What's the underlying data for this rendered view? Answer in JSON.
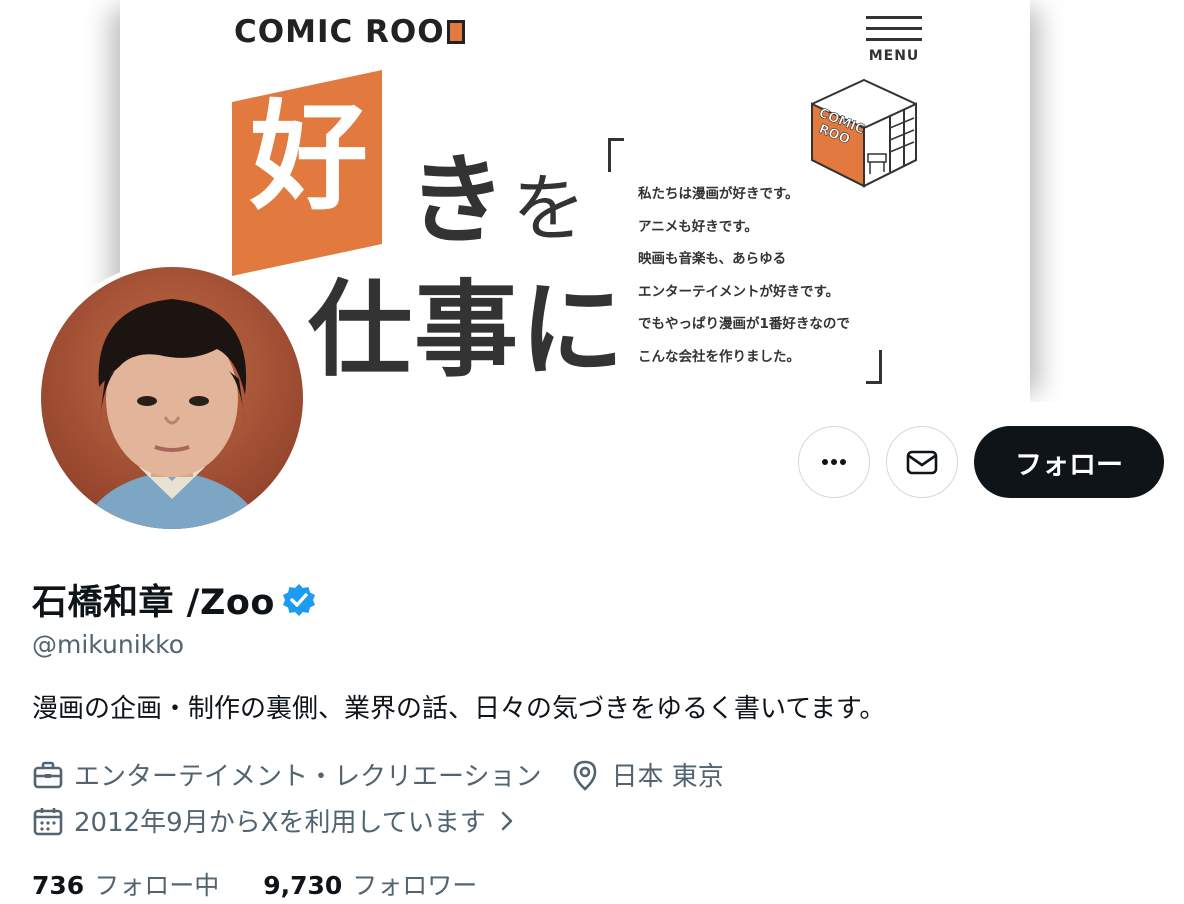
{
  "banner": {
    "brand": "COMIC ROO",
    "menu_label": "MENU",
    "room_sign_line1": "COMIC",
    "room_sign_line2": "ROO",
    "headline_suki": "好",
    "headline_ki": "き",
    "headline_wo": "を",
    "headline_shigoto": "仕事に",
    "blurb": [
      "私たちは漫画が好きです。",
      "アニメも好きです。",
      "映画も音楽も、あらゆる",
      "エンターテイメントが好きです。",
      "でもやっぱり漫画が1番好きなので",
      "こんな会社を作りました。"
    ]
  },
  "actions": {
    "more_icon": "more-icon",
    "message_icon": "mail-icon",
    "follow_label": "フォロー"
  },
  "profile": {
    "display_name": "石橋和章 /Zoo",
    "verified_icon": "verified-badge-icon",
    "handle": "@mikunikko",
    "bio": "漫画の企画・制作の裏側、業界の話、日々の気づきをゆるく書いてます。",
    "category": "エンターテイメント・レクリエーション",
    "location": "日本 東京",
    "joined": "2012年9月からXを利用しています",
    "icons": {
      "category": "briefcase-icon",
      "location": "location-pin-icon",
      "joined": "calendar-icon",
      "joined_more": "chevron-right-icon"
    }
  },
  "stats": {
    "following_count": "736",
    "following_label": "フォロー中",
    "followers_count": "9,730",
    "followers_label": "フォロワー"
  },
  "colors": {
    "accent_orange": "#e27a3f",
    "follow_button": "#0f1419",
    "verified_blue": "#1d9bf0",
    "secondary_text": "#536471"
  }
}
